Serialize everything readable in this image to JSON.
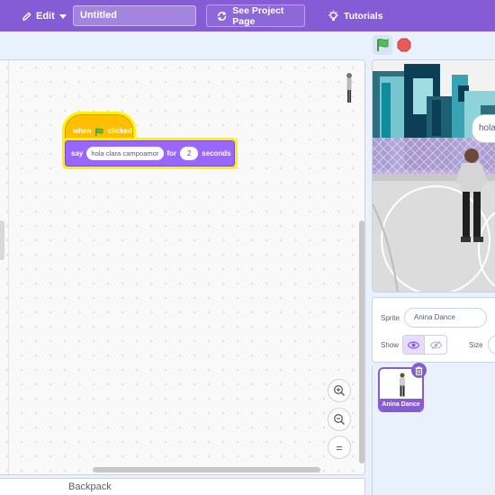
{
  "menubar": {
    "edit_label": "Edit",
    "project_title": "Untitled",
    "see_project_label": "See Project Page",
    "tutorials_label": "Tutorials",
    "bg_color": "#855cd6"
  },
  "script_area": {
    "hat_block": {
      "when_label": "when",
      "clicked_label": "clicked",
      "color": "#ffbf00"
    },
    "say_block": {
      "say_label": "say",
      "message": "hola clara campoamor",
      "for_label": "for",
      "seconds_value": "2",
      "seconds_label": "seconds",
      "color": "#9966ff"
    },
    "zoom_in_symbol": "+",
    "zoom_out_symbol": "−",
    "zoom_reset_symbol": "="
  },
  "backpack": {
    "label": "Backpack"
  },
  "stage": {
    "speech_text": "hola"
  },
  "sprite_info": {
    "sprite_label": "Sprite",
    "sprite_name": "Anina Dance",
    "show_label": "Show",
    "size_label": "Size"
  },
  "sprite_list": {
    "items": [
      {
        "name": "Anina Dance",
        "selected": true
      }
    ]
  }
}
